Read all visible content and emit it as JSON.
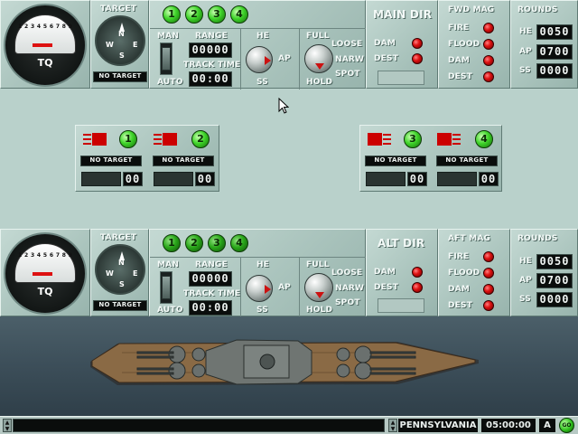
{
  "top_panel": {
    "gauge_label": "TQ",
    "gauge_scale": [
      "1",
      "2",
      "3",
      "4",
      "5",
      "6",
      "7",
      "8",
      "9"
    ],
    "target_label": "TARGET",
    "compass": {
      "n": "N",
      "s": "S",
      "e": "E",
      "w": "W"
    },
    "target_status": "NO TARGET",
    "turret_buttons": [
      "1",
      "2",
      "3",
      "4"
    ],
    "man_label": "MAN",
    "auto_label": "AUTO",
    "range_label": "RANGE",
    "range_value": "00000",
    "track_time_label": "TRACK TIME",
    "track_time_value": "00:00",
    "he_label": "HE",
    "ap_label": "AP",
    "ss_label": "SS",
    "full_label": "FULL",
    "hold_label": "HOLD",
    "loose_label": "LOOSE",
    "narrow_label": "NARW",
    "spot_label": "SPOT",
    "director_title": "MAIN DIR",
    "dam_label": "DAM",
    "dest_label": "DEST",
    "mag_title": "FWD MAG",
    "mag_items": [
      "FIRE",
      "FLOOD",
      "DAM",
      "DEST"
    ],
    "rounds_title": "ROUNDS",
    "rounds": [
      {
        "label": "HE",
        "value": "0050"
      },
      {
        "label": "AP",
        "value": "0700"
      },
      {
        "label": "SS",
        "value": "0000"
      }
    ]
  },
  "bottom_panel": {
    "gauge_label": "TQ",
    "gauge_scale": [
      "1",
      "2",
      "3",
      "4",
      "5",
      "6",
      "7",
      "8",
      "9"
    ],
    "target_label": "TARGET",
    "compass": {
      "n": "N",
      "s": "S",
      "e": "E",
      "w": "W"
    },
    "target_status": "NO TARGET",
    "turret_buttons": [
      "1",
      "2",
      "3",
      "4"
    ],
    "man_label": "MAN",
    "auto_label": "AUTO",
    "range_label": "RANGE",
    "range_value": "00000",
    "track_time_label": "TRACK TIME",
    "track_time_value": "00:00",
    "he_label": "HE",
    "ap_label": "AP",
    "ss_label": "SS",
    "full_label": "FULL",
    "hold_label": "HOLD",
    "loose_label": "LOOSE",
    "narrow_label": "NARW",
    "spot_label": "SPOT",
    "director_title": "ALT DIR",
    "dam_label": "DAM",
    "dest_label": "DEST",
    "mag_title": "AFT MAG",
    "mag_items": [
      "FIRE",
      "FLOOD",
      "DAM",
      "DEST"
    ],
    "rounds_title": "ROUNDS",
    "rounds": [
      {
        "label": "HE",
        "value": "0050"
      },
      {
        "label": "AP",
        "value": "0700"
      },
      {
        "label": "SS",
        "value": "0000"
      }
    ]
  },
  "turrets": [
    {
      "number": "1",
      "status": "NO TARGET",
      "count": "00"
    },
    {
      "number": "2",
      "status": "NO TARGET",
      "count": "00"
    },
    {
      "number": "3",
      "status": "NO TARGET",
      "count": "00"
    },
    {
      "number": "4",
      "status": "NO TARGET",
      "count": "00"
    }
  ],
  "status_bar": {
    "ship_name": "PENNSYLVANIA",
    "clock": "05:00:00",
    "mode": "A",
    "go_label": "GO"
  },
  "colors": {
    "panel": "#b9d1cb",
    "led_red": "#d11111",
    "button_green": "#3fd42a",
    "lcd": "#0a0d0c",
    "sea": "#3c4e59",
    "deck": "#8a6a45"
  }
}
